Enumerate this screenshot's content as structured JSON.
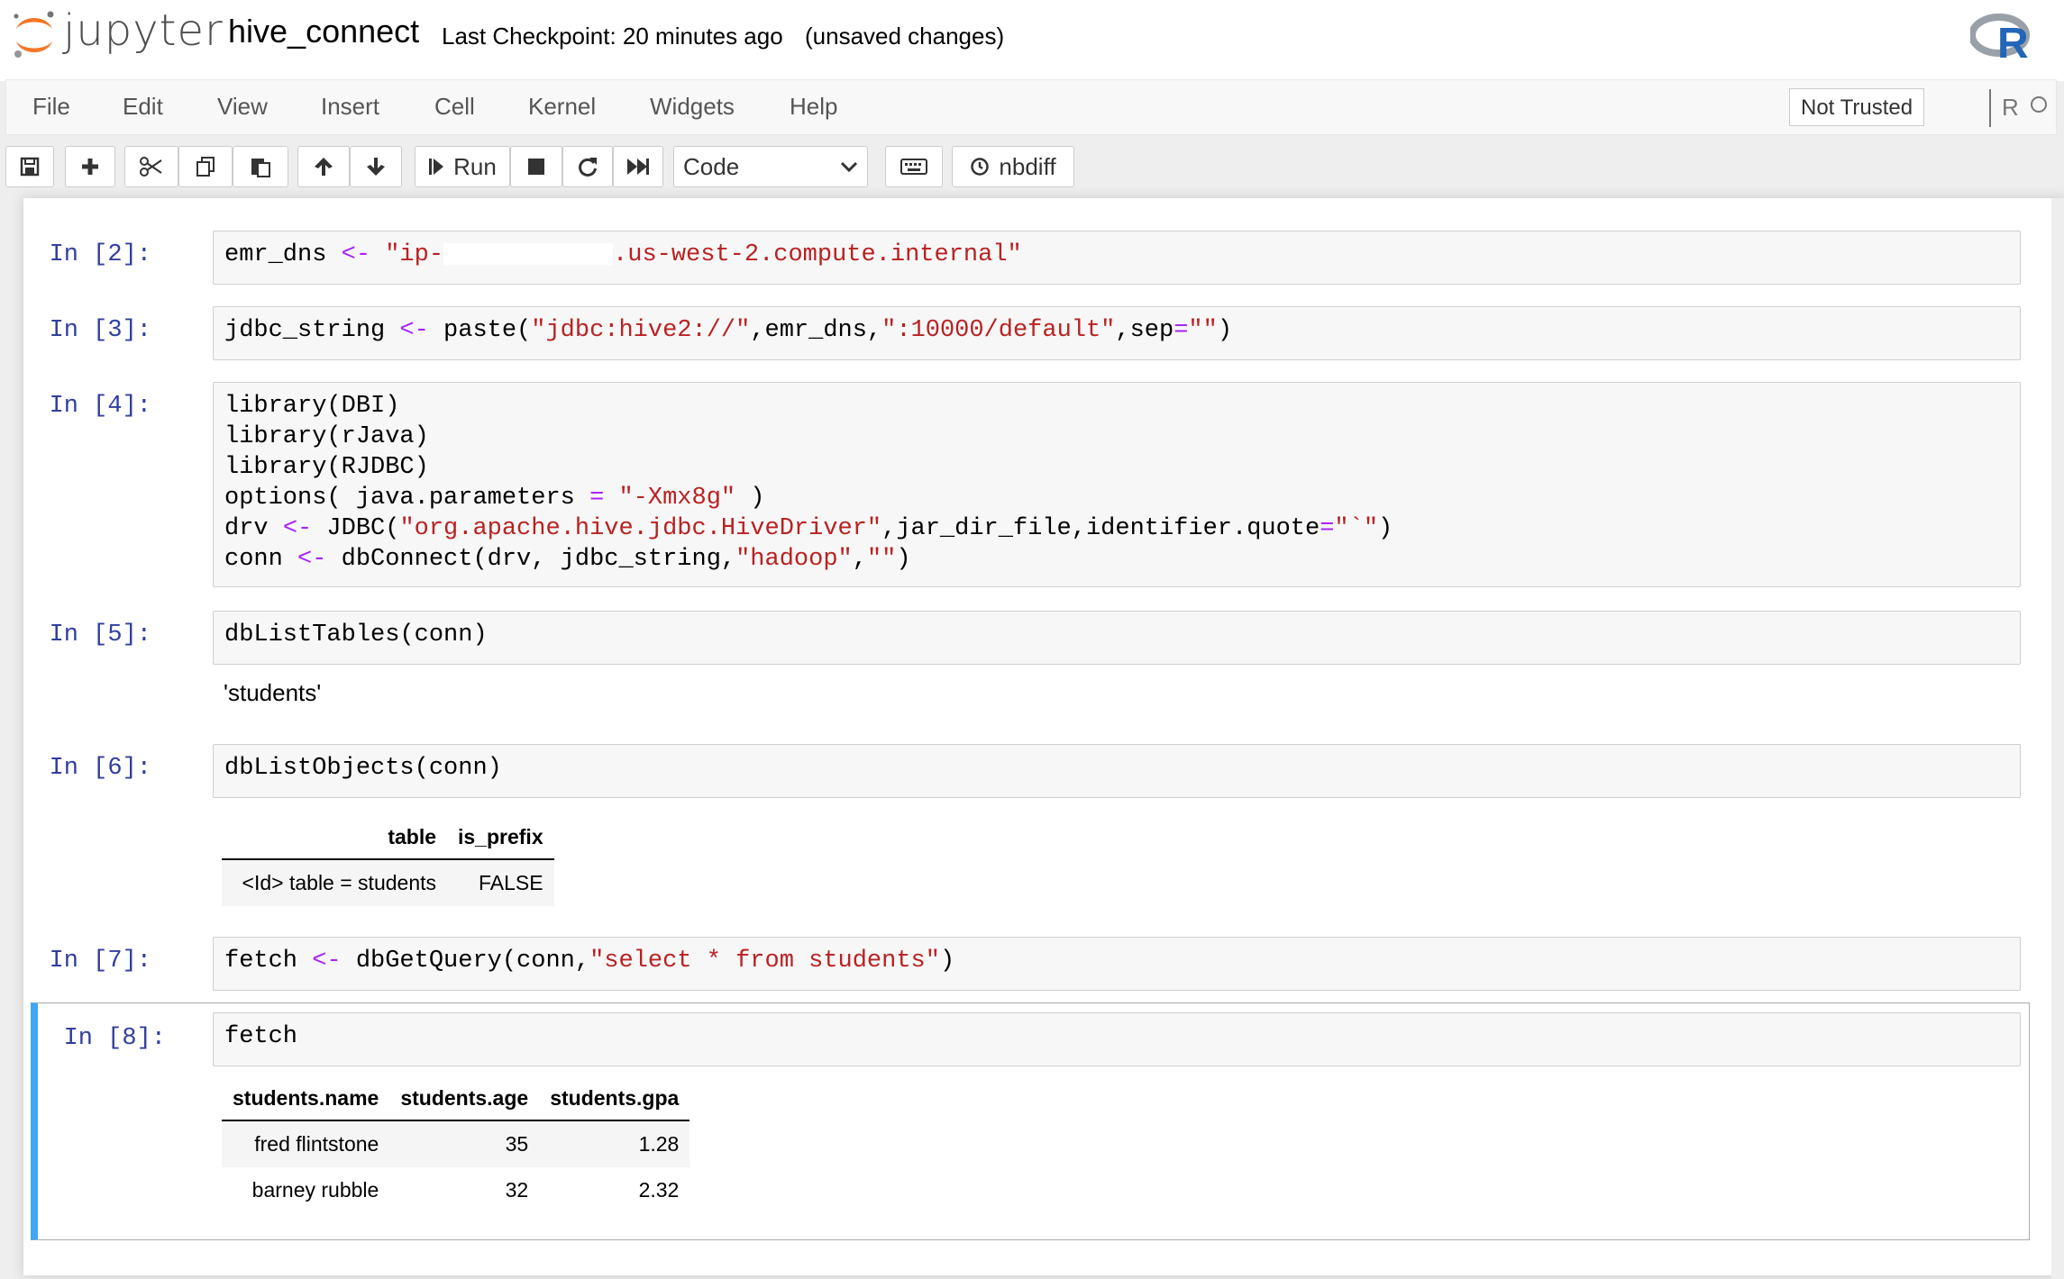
{
  "header": {
    "logo_text": "jupyter",
    "notebook_name": "hive_connect",
    "checkpoint": "Last Checkpoint: 20 minutes ago",
    "unsaved": "(unsaved changes)",
    "kernel_logo_letter": "R"
  },
  "menubar": {
    "items": [
      "File",
      "Edit",
      "View",
      "Insert",
      "Cell",
      "Kernel",
      "Widgets",
      "Help"
    ],
    "trusted": "Not Trusted",
    "kernel_name": "R"
  },
  "toolbar": {
    "run_label": "Run",
    "cell_type": "Code",
    "nbdiff_label": "nbdiff"
  },
  "cells": [
    {
      "prompt": "In [2]:"
    },
    {
      "prompt": "In [3]:"
    },
    {
      "prompt": "In [4]:"
    },
    {
      "prompt": "In [5]:",
      "output": "'students'"
    },
    {
      "prompt": "In [6]:"
    },
    {
      "prompt": "In [7]:"
    },
    {
      "prompt": "In [8]:"
    }
  ],
  "code": {
    "c2": {
      "a": "emr_dns ",
      "op": "<-",
      "s1": " \"ip-",
      "s2": ".us-west-2.compute.internal\""
    },
    "c3": {
      "a": "jdbc_string ",
      "op": "<-",
      "b": " paste(",
      "s1": "\"jdbc:hive2://\"",
      "c": ",emr_dns,",
      "s2": "\":10000/default\"",
      "d": ",sep",
      "op2": "=",
      "s3": "\"\"",
      "e": ")"
    },
    "c4": {
      "l1": "library(DBI)",
      "l2": "library(rJava)",
      "l3": "library(RJDBC)",
      "l4a": "options( java.parameters ",
      "l4op": "=",
      "l4s": " \"-Xmx8g\"",
      "l4b": " )",
      "l5a": "drv ",
      "l5op": "<-",
      "l5b": " JDBC(",
      "l5s1": "\"org.apache.hive.jdbc.HiveDriver\"",
      "l5c": ",jar_dir_file,identifier.quote",
      "l5op2": "=",
      "l5s2": "\"`\"",
      "l5d": ")",
      "l6a": "conn ",
      "l6op": "<-",
      "l6b": " dbConnect(drv, jdbc_string,",
      "l6s1": "\"hadoop\"",
      "l6c": ",",
      "l6s2": "\"\"",
      "l6d": ")"
    },
    "c5": "dbListTables(conn)",
    "c6": "dbListObjects(conn)",
    "c7": {
      "a": "fetch ",
      "op": "<-",
      "b": " dbGetQuery(conn,",
      "s": "\"select * from students\"",
      "c": ")"
    },
    "c8": "fetch"
  },
  "objects_table": {
    "headers": [
      "table",
      "is_prefix"
    ],
    "rows": [
      [
        "<Id> table = students",
        "FALSE"
      ]
    ]
  },
  "fetch_table": {
    "headers": [
      "students.name",
      "students.age",
      "students.gpa"
    ],
    "rows": [
      [
        "fred flintstone",
        "35",
        "1.28"
      ],
      [
        "barney rubble",
        "32",
        "2.32"
      ]
    ]
  }
}
